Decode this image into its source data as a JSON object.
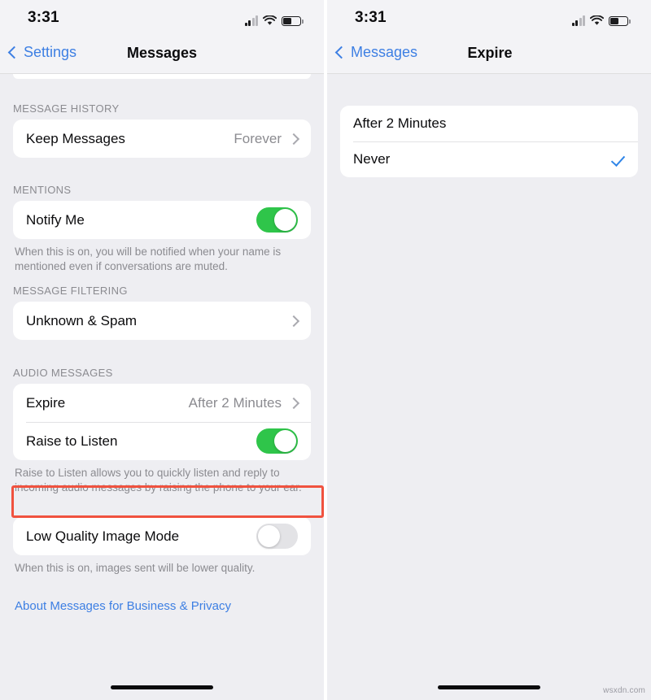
{
  "left_phone": {
    "statusbar": {
      "time": "3:31",
      "cellular_icon": "cellular-signal-icon",
      "wifi_icon": "wifi-icon",
      "battery_icon": "battery-icon"
    },
    "navbar": {
      "back_label": "Settings",
      "title": "Messages",
      "back_icon": "chevron-left-icon"
    },
    "sections": [
      {
        "header": "MESSAGE HISTORY",
        "rows": [
          {
            "label": "Keep Messages",
            "value": "Forever",
            "accessory": "disclosure-chevron-icon"
          }
        ],
        "footnote": ""
      },
      {
        "header": "MENTIONS",
        "rows": [
          {
            "label": "Notify Me",
            "accessory": "toggle",
            "toggle_state": "on"
          }
        ],
        "footnote": "When this is on, you will be notified when your name is mentioned even if conversations are muted."
      },
      {
        "header": "MESSAGE FILTERING",
        "rows": [
          {
            "label": "Unknown & Spam",
            "value": "",
            "accessory": "disclosure-chevron-icon"
          }
        ],
        "footnote": ""
      },
      {
        "header": "AUDIO MESSAGES",
        "rows": [
          {
            "label": "Expire",
            "value": "After 2 Minutes",
            "accessory": "disclosure-chevron-icon",
            "highlighted": true
          },
          {
            "label": "Raise to Listen",
            "accessory": "toggle",
            "toggle_state": "on"
          }
        ],
        "footnote": "Raise to Listen allows you to quickly listen and reply to incoming audio messages by raising the phone to your ear."
      },
      {
        "header": "",
        "rows": [
          {
            "label": "Low Quality Image Mode",
            "accessory": "toggle",
            "toggle_state": "off"
          }
        ],
        "footnote": "When this is on, images sent will be lower quality."
      }
    ],
    "link": "About Messages for Business & Privacy",
    "home_indicator": "home-indicator"
  },
  "right_phone": {
    "statusbar": {
      "time": "3:31",
      "cellular_icon": "cellular-signal-icon",
      "wifi_icon": "wifi-icon",
      "battery_icon": "battery-icon"
    },
    "navbar": {
      "back_label": "Messages",
      "title": "Expire",
      "back_icon": "chevron-left-icon"
    },
    "options": [
      {
        "label": "After 2 Minutes",
        "selected": false
      },
      {
        "label": "Never",
        "selected": true
      }
    ],
    "home_indicator": "home-indicator"
  },
  "watermark": "wsxdn.com",
  "colors": {
    "accent_blue": "#3d7fe3",
    "check_blue": "#2f85e8",
    "toggle_on_green": "#2fc54a",
    "toggle_off_gray": "#e3e3e6",
    "highlight_red": "#f0523f",
    "page_bg": "#eeeef2",
    "card_bg": "#ffffff",
    "secondary_text": "#8b8b90"
  }
}
